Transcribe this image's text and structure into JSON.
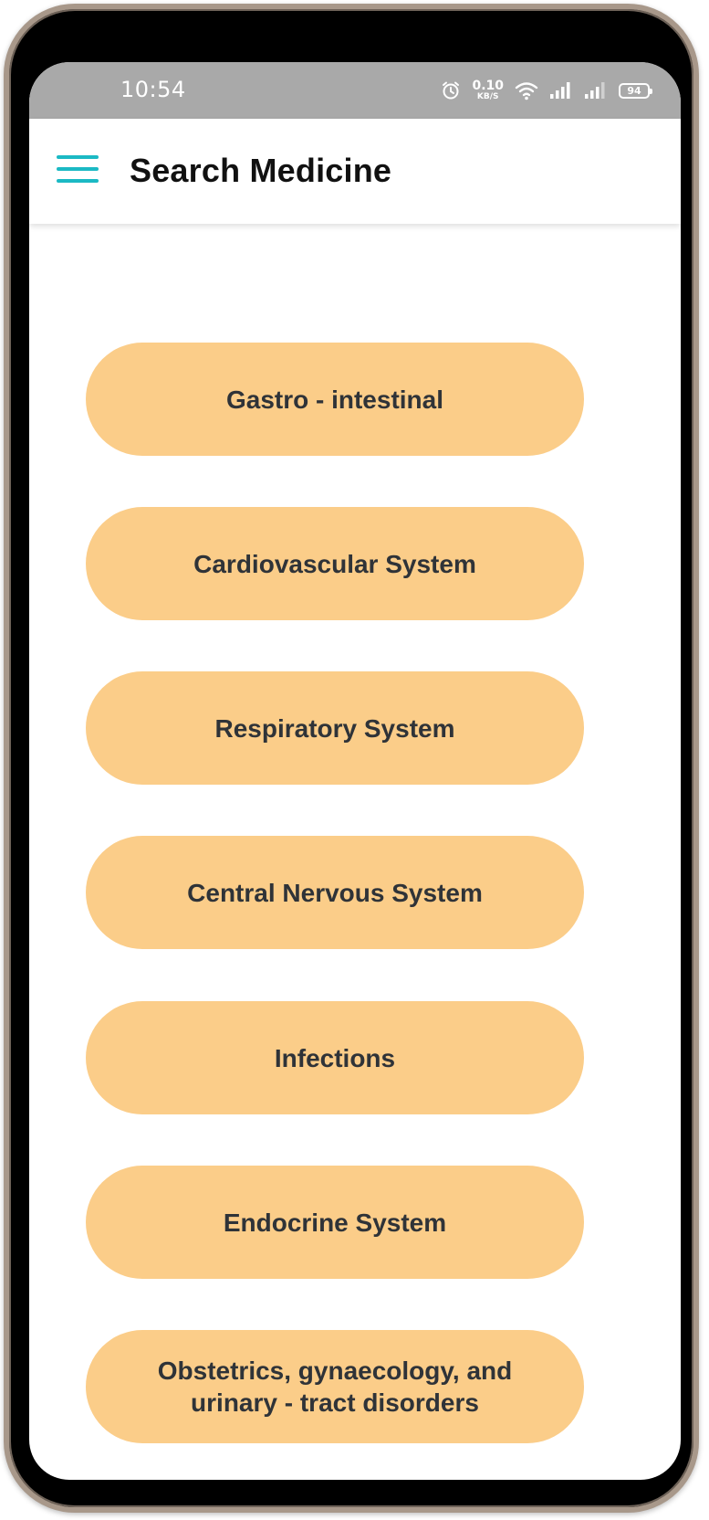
{
  "status_bar": {
    "time": "10:54",
    "net_speed_value": "0.10",
    "net_speed_unit": "KB/S",
    "battery": "94",
    "icons": [
      "alarm-icon",
      "wifi-icon",
      "signal-icon",
      "signal-icon"
    ]
  },
  "app_bar": {
    "title": "Search Medicine",
    "menu_icon": "hamburger-menu-icon"
  },
  "categories": [
    {
      "label": "Gastro - intestinal"
    },
    {
      "label": "Cardiovascular System"
    },
    {
      "label": "Respiratory System"
    },
    {
      "label": "Central Nervous System"
    },
    {
      "label": "Infections"
    },
    {
      "label": "Endocrine System"
    },
    {
      "label": "Obstetrics, gynaecology, and\nurinary - tract disorders"
    }
  ],
  "colors": {
    "accent": "#1bb9c4",
    "button_fill": "#fbcd89",
    "button_text": "#2f3338",
    "status_bar": "#a9a9a9"
  }
}
